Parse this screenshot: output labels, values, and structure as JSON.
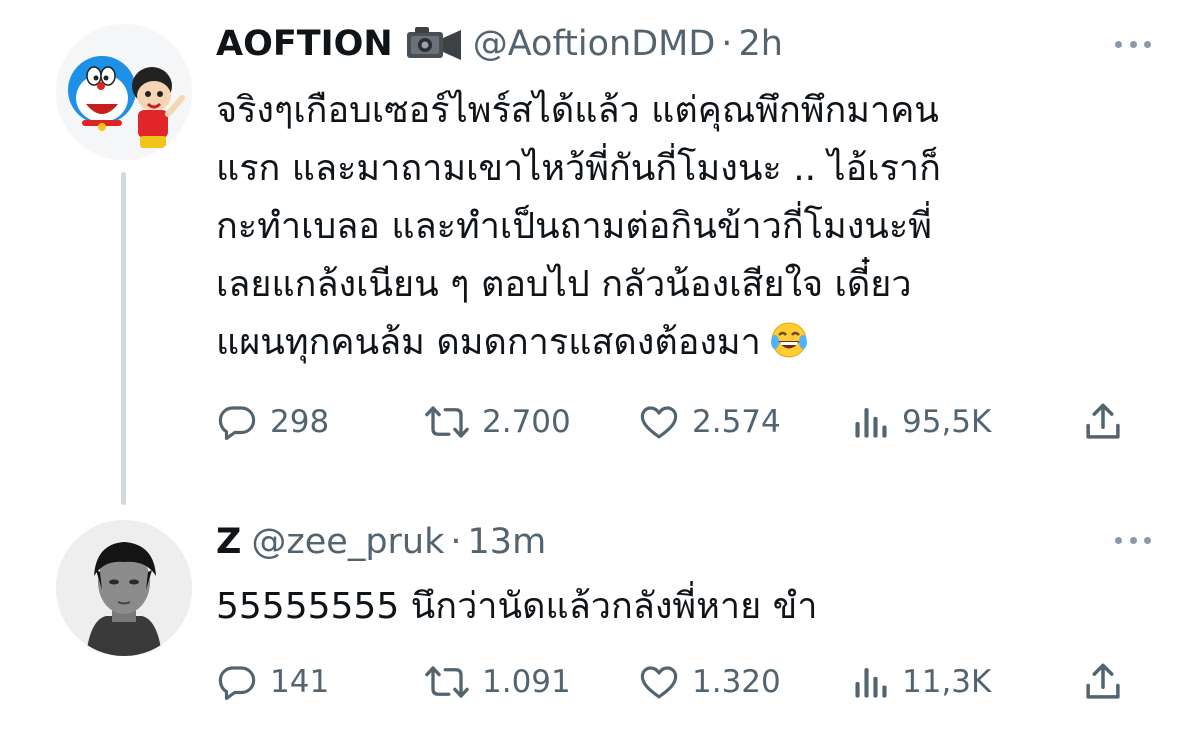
{
  "tweets": [
    {
      "display_name": "AOFTION",
      "badge_icon": "video-camera-emoji",
      "handle": "@AoftionDMD",
      "separator": "·",
      "time": "2h",
      "text_lines": [
        "จริงๆเกือบเซอร์ไพร์สได้แล้ว แต่คุณพึกพึกมาคน",
        "แรก และมาถามเขาไหว้พี่กันกี่โมงนะ .. ไอ้เราก็",
        "กะทำเบลอ และทำเป็นถามต่อกินข้าวกี่โมงนะพี่",
        "เลยแกล้งเนียน ๆ ตอบไป กลัวน้องเสียใจ เดี๋ยว",
        "แผนทุกคนล้ม ดมดการแสดงต้องมา"
      ],
      "text_emoji": "😂",
      "counts": {
        "replies": "298",
        "retweets": "2.700",
        "likes": "2.574",
        "views": "95,5K"
      }
    },
    {
      "display_name": "Z",
      "handle": "@zee_pruk",
      "separator": "·",
      "time": "13m",
      "text_lines": [
        "55555555 นึกว่านัดแล้วกลังพี่หาย ขำ"
      ],
      "counts": {
        "replies": "141",
        "retweets": "1.091",
        "likes": "1.320",
        "views": "11,3K"
      }
    }
  ],
  "colors": {
    "text": "#0f1419",
    "secondary": "#536471",
    "thread_line": "#cfd9de"
  },
  "icons": [
    "reply-icon",
    "retweet-icon",
    "like-icon",
    "views-icon",
    "share-icon",
    "more-icon"
  ]
}
